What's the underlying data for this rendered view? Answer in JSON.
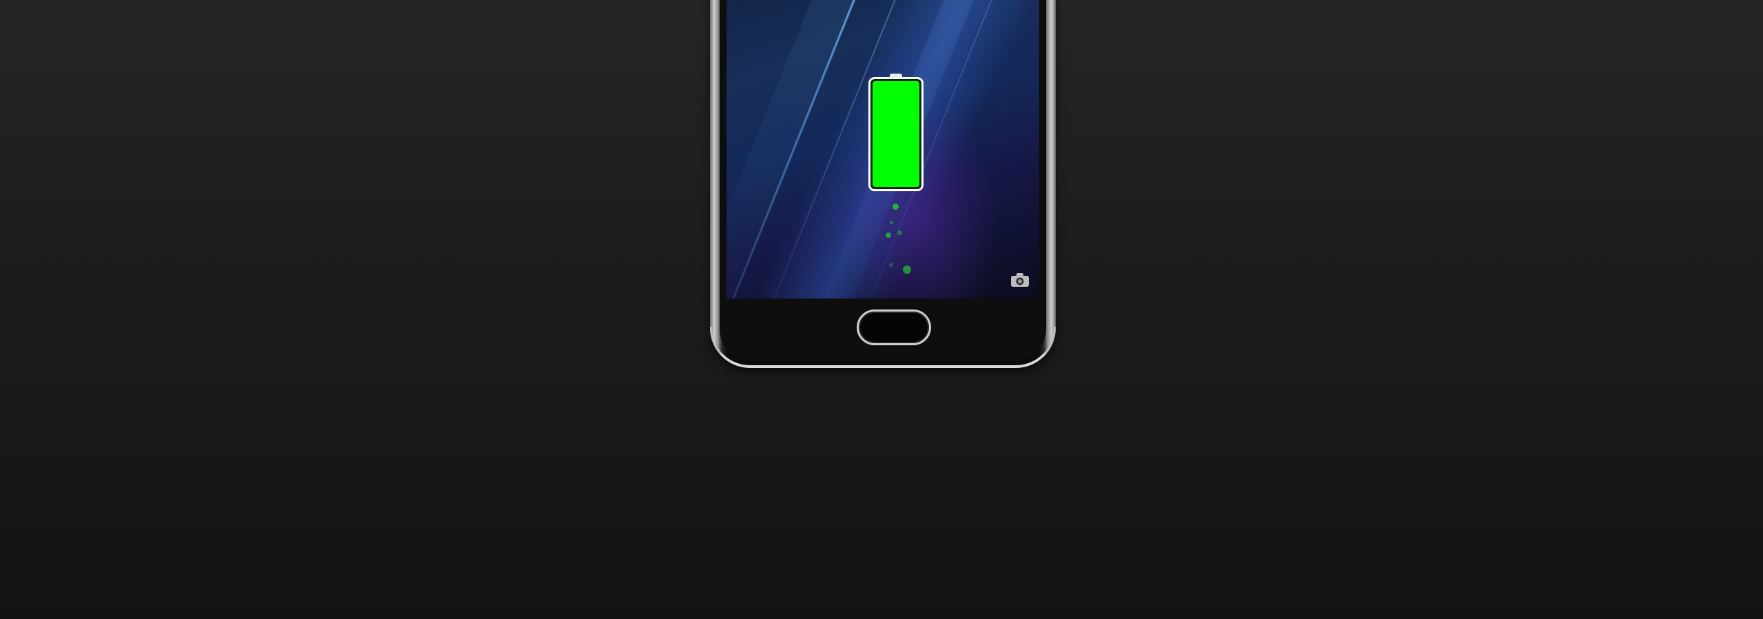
{
  "device": {
    "type": "smartphone",
    "screen": "lock-screen-charging",
    "battery": {
      "charge_level": 1.0,
      "fill_color": "#00ff00",
      "state": "charging"
    },
    "icons": {
      "battery": "battery-icon",
      "camera": "camera-icon",
      "home": "home-button"
    },
    "colors": {
      "background_top": "#252525",
      "background_bottom": "#131313",
      "screen_blue": "#172e59",
      "screen_purple": "#50289f",
      "frame_silver": "#cfcfcf",
      "charging_dot": "#1fbf2a"
    }
  }
}
